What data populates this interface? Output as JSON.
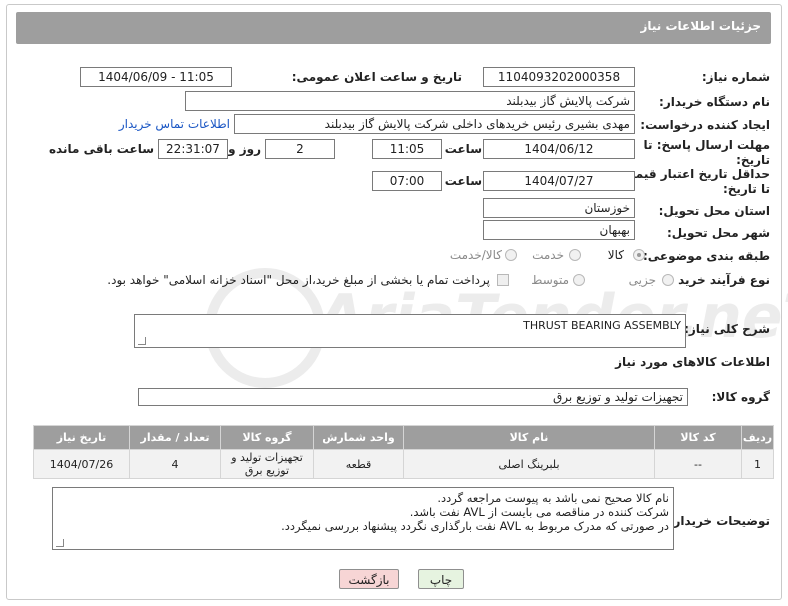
{
  "header": {
    "title": "جزئیات اطلاعات نیاز"
  },
  "form": {
    "need_number": {
      "label": "شماره نیاز:",
      "value": "1104093202000358"
    },
    "announce": {
      "label": "تاریخ و ساعت اعلان عمومی:",
      "value": "1404/06/09 - 11:05"
    },
    "buyer_org": {
      "label": "نام دستگاه خریدار:",
      "value": "شرکت پالایش گاز بیدبلند"
    },
    "requester": {
      "label": "ایجاد کننده درخواست:",
      "value": "مهدی بشیری رئیس خریدهای داخلی شرکت پالایش گاز بیدبلند",
      "link": "اطلاعات تماس خریدار"
    },
    "reply_deadline": {
      "label_line1": "مهلت ارسال پاسخ: تا",
      "label_line2": "تاریخ:",
      "date": "1404/06/12",
      "time_label": "ساعت",
      "time": "11:05",
      "days": "2",
      "days_label": "روز و",
      "remaining": "22:31:07",
      "remaining_label": "ساعت باقی مانده"
    },
    "price_validity": {
      "label_line1": "حداقل تاریخ اعتبار قیمت:",
      "label_line2": "تا تاریخ:",
      "date": "1404/07/27",
      "time_label": "ساعت",
      "time": "07:00"
    },
    "province": {
      "label": "استان محل تحویل:",
      "value": "خوزستان"
    },
    "city": {
      "label": "شهر محل تحویل:",
      "value": "بهبهان"
    },
    "category": {
      "label": "طبقه بندی موضوعی:",
      "options": [
        {
          "label": "کالا",
          "selected": true
        },
        {
          "label": "خدمت",
          "selected": false
        },
        {
          "label": "کالا/خدمت",
          "selected": false
        }
      ]
    },
    "purchase_type": {
      "label": "نوع فرآیند خرید :",
      "options": [
        {
          "label": "جزیی",
          "selected": false
        },
        {
          "label": "متوسط",
          "selected": false
        }
      ],
      "payment_text": "پرداخت تمام یا بخشی از مبلغ خرید،از محل \"اسناد خزانه اسلامی\" خواهد بود."
    }
  },
  "need_desc": {
    "label": "شرح کلی نیاز:",
    "value": "THRUST BEARING ASSEMBLY"
  },
  "goods_section": {
    "title": "اطلاعات کالاهای مورد نیاز"
  },
  "goods_group": {
    "label": "گروه کالا:",
    "value": "تجهیزات تولید و توزیع برق"
  },
  "table": {
    "headers": [
      "ردیف",
      "کد کالا",
      "نام کالا",
      "واحد شمارش",
      "گروه کالا",
      "تعداد / مقدار",
      "تاریخ نیاز"
    ],
    "rows": [
      [
        "1",
        "--",
        "بلبرینگ اصلی",
        "قطعه",
        "تجهیزات تولید و توزیع برق",
        "4",
        "1404/07/26"
      ]
    ]
  },
  "buyer_notes": {
    "label": "توضیحات خریدار:",
    "lines": [
      "نام کالا صحیح نمی باشد به پیوست مراجعه گردد.",
      "شرکت کننده در مناقصه می بایست از AVL نفت باشد.",
      "در صورتی که مدرک مربوط به AVL نفت بارگذاری نگردد پیشنهاد بررسی نمیگردد."
    ]
  },
  "buttons": {
    "print": "چاپ",
    "back": "بازگشت"
  },
  "watermark": {
    "text": "AriaTender.neT"
  },
  "colors": {
    "header_bg": "#9e9e9e",
    "link": "#1a56c4",
    "back_button_bg": "#f7d5d5",
    "print_button_bg": "#e6f3e0"
  }
}
